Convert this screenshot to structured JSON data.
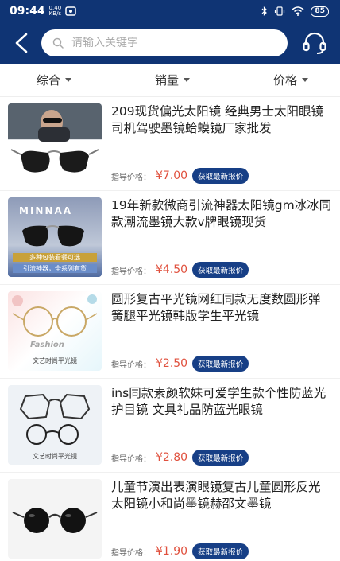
{
  "status_bar": {
    "time": "09:44",
    "net_speed_value": "0.40",
    "net_speed_unit": "KB/s",
    "battery": "85"
  },
  "header": {
    "search_placeholder": "请输入关键字"
  },
  "sort": {
    "items": [
      {
        "label": "综合"
      },
      {
        "label": "销量"
      },
      {
        "label": "价格"
      }
    ]
  },
  "products": [
    {
      "title": "209现货偏光太阳镜 经典男士太阳眼镜司机驾驶墨镜蛤蟆镜厂家批发",
      "price_label": "指导价格：",
      "price": "¥7.00",
      "button": "获取最新报价"
    },
    {
      "title": "19年新款微商引流神器太阳镜gm冰冰同款潮流墨镜大款v牌眼镜现货",
      "price_label": "指导价格：",
      "price": "¥4.50",
      "button": "获取最新报价",
      "image_texts": [
        "MINNAA",
        "多种包装看餐可选",
        "引流神器，全系列有货"
      ]
    },
    {
      "title": "圆形复古平光镜网红同款无度数圆形弹簧腿平光镜韩版学生平光镜",
      "price_label": "指导价格：",
      "price": "¥2.50",
      "button": "获取最新报价",
      "image_texts": [
        "Fashion",
        "文艺时尚平光镜"
      ]
    },
    {
      "title": "ins同款素颜软妹可爱学生款个性防蓝光护目镜 文具礼品防蓝光眼镜",
      "price_label": "指导价格：",
      "price": "¥2.80",
      "button": "获取最新报价",
      "image_texts": [
        "文艺时尚平光镜"
      ]
    },
    {
      "title": "儿童节演出表演眼镜复古儿童圆形反光太阳镜小和尚墨镜赫邵文墨镜",
      "price_label": "指导价格：",
      "price": "¥1.90",
      "button": "获取最新报价"
    }
  ]
}
